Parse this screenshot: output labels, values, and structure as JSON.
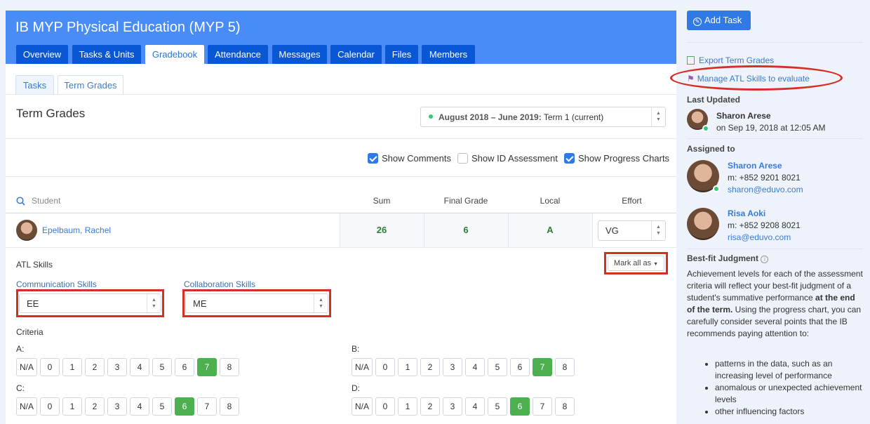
{
  "course": {
    "title": "IB MYP Physical Education (MYP 5)"
  },
  "tabs": [
    "Overview",
    "Tasks & Units",
    "Gradebook",
    "Attendance",
    "Messages",
    "Calendar",
    "Files",
    "Members"
  ],
  "active_tab": "Gradebook",
  "subtabs": [
    "Tasks",
    "Term Grades"
  ],
  "active_subtab": "Term Grades",
  "section_title": "Term Grades",
  "term_select": {
    "bold": "August 2018 – June 2019:",
    "rest": " Term 1 (current)"
  },
  "options": [
    {
      "label": "Show Comments",
      "checked": true
    },
    {
      "label": "Show ID Assessment",
      "checked": false
    },
    {
      "label": "Show Progress Charts",
      "checked": true
    }
  ],
  "table": {
    "search_placeholder": "Student",
    "columns": {
      "sum": "Sum",
      "final": "Final Grade",
      "local": "Local",
      "effort": "Effort"
    },
    "row": {
      "name": "Epelbaum, Rachel",
      "sum": "26",
      "final": "6",
      "local": "A",
      "effort": "VG"
    }
  },
  "atl": {
    "heading": "ATL Skills",
    "mark_all": "Mark all as",
    "communication": {
      "label": "Communication Skills",
      "value": "EE"
    },
    "collaboration": {
      "label": "Collaboration Skills",
      "value": "ME"
    }
  },
  "criteria": {
    "heading": "Criteria",
    "buttons": [
      "N/A",
      "0",
      "1",
      "2",
      "3",
      "4",
      "5",
      "6",
      "7",
      "8"
    ],
    "items": [
      {
        "label": "A:",
        "selected": "7"
      },
      {
        "label": "B:",
        "selected": "7"
      },
      {
        "label": "C:",
        "selected": "6"
      },
      {
        "label": "D:",
        "selected": "6"
      }
    ]
  },
  "sidebar": {
    "add_task": "Add Task",
    "export": "Export Term Grades",
    "manage_atl": "Manage ATL Skills to evaluate",
    "last_updated_heading": "Last Updated",
    "last_updated_name": "Sharon Arese",
    "last_updated_when": "on Sep 19, 2018 at 12:05 AM",
    "assigned_heading": "Assigned to",
    "assignees": [
      {
        "name": "Sharon Arese",
        "phone": "m: +852 9201 8021",
        "email": "sharon@eduvo.com"
      },
      {
        "name": "Risa Aoki",
        "phone": "m: +852 9208 8021",
        "email": "risa@eduvo.com"
      }
    ],
    "bestfit_heading": "Best-fit Judgment",
    "bestfit_text_1": "Achievement levels for each of the assessment criteria will reflect your best-fit judgment of a student's summative performance ",
    "bestfit_bold": "at the end of the term.",
    "bestfit_text_2": " Using the progress chart, you can carefully consider several points that the IB recommends paying attention to:",
    "bestfit_points": [
      "patterns in the data, such as an increasing level of performance",
      "anomalous or unexpected achievement levels",
      "other influencing factors"
    ]
  },
  "colors": {
    "header": "#4a8cf6",
    "tab": "#0a57d6",
    "accent": "#2f7ae5",
    "selected_grade": "#4caf50",
    "highlight": "#d62e24"
  }
}
